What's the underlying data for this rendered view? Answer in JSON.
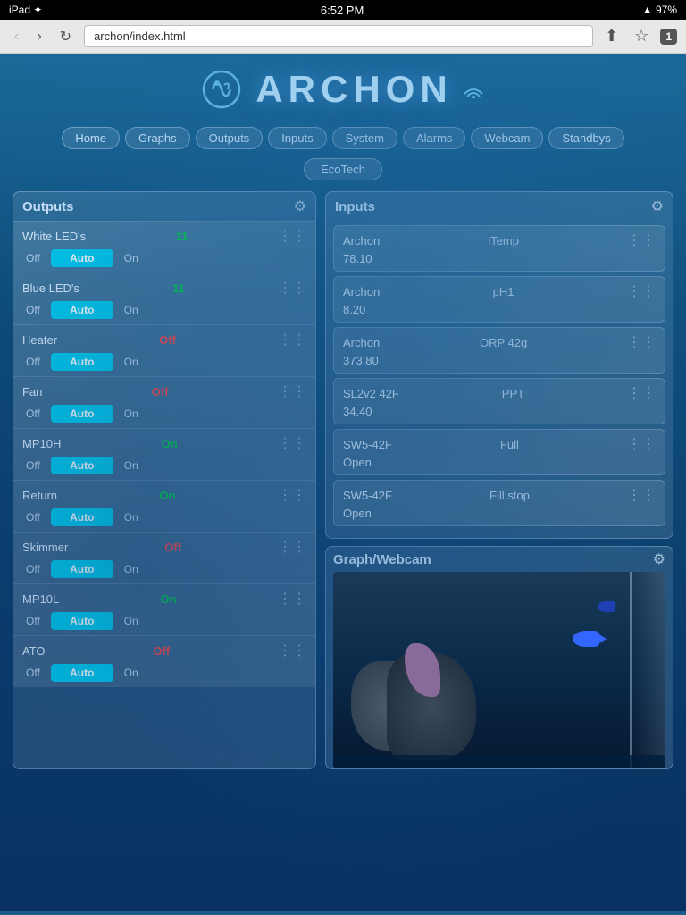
{
  "statusBar": {
    "left": "iPad ✦",
    "time": "6:52 PM",
    "right": "▲ 97%"
  },
  "browser": {
    "address": "archon/index.html",
    "tabCount": "1"
  },
  "nav": {
    "items": [
      "Home",
      "Graphs",
      "Outputs",
      "Inputs",
      "System",
      "Alarms",
      "Webcam",
      "Standbys"
    ],
    "extra": "EcoTech"
  },
  "outputs": {
    "title": "Outputs",
    "items": [
      {
        "name": "White LED's",
        "status": "11",
        "statusType": "on",
        "off": "Off",
        "auto": "Auto",
        "on": "On"
      },
      {
        "name": "Blue LED's",
        "status": "11",
        "statusType": "on",
        "off": "Off",
        "auto": "Auto",
        "on": "On"
      },
      {
        "name": "Heater",
        "status": "Off",
        "statusType": "off",
        "off": "Off",
        "auto": "Auto",
        "on": "On"
      },
      {
        "name": "Fan",
        "status": "Off",
        "statusType": "off",
        "off": "Off",
        "auto": "Auto",
        "on": "On"
      },
      {
        "name": "MP10H",
        "status": "On",
        "statusType": "on",
        "off": "Off",
        "auto": "Auto",
        "on": "On"
      },
      {
        "name": "Return",
        "status": "On",
        "statusType": "on",
        "off": "Off",
        "auto": "Auto",
        "on": "On"
      },
      {
        "name": "Skimmer",
        "status": "Off",
        "statusType": "off",
        "off": "Off",
        "auto": "Auto",
        "on": "On"
      },
      {
        "name": "MP10L",
        "status": "On",
        "statusType": "on",
        "off": "Off",
        "auto": "Auto",
        "on": "On"
      },
      {
        "name": "ATO",
        "status": "Off",
        "statusType": "off",
        "off": "Off",
        "auto": "Auto",
        "on": "On"
      }
    ]
  },
  "inputs": {
    "title": "Inputs",
    "items": [
      {
        "source": "Archon",
        "name": "iTemp",
        "value": "78.10"
      },
      {
        "source": "Archon",
        "name": "pH1",
        "value": "8.20"
      },
      {
        "source": "Archon",
        "name": "ORP 42g",
        "value": "373.80"
      },
      {
        "source": "SL2v2 42F",
        "name": "PPT",
        "value": "34.40"
      },
      {
        "source": "SW5-42F",
        "name": "Full",
        "value": "Open"
      },
      {
        "source": "SW5-42F",
        "name": "Fill stop",
        "value": "Open"
      }
    ]
  },
  "graph": {
    "title": "Graph/Webcam"
  },
  "icons": {
    "gear": "⚙",
    "slider": "⋮⋮",
    "back": "‹",
    "forward": "›",
    "reload": "↻",
    "share": "⬆",
    "bookmark": "☆"
  }
}
